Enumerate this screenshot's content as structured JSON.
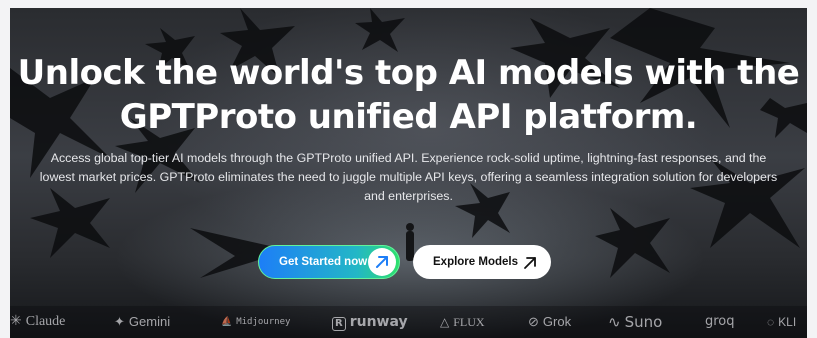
{
  "hero": {
    "title_line1": "Unlock the world's top AI models with the",
    "title_line2": "GPTProto unified API platform.",
    "subtitle_line1": "Access global top-tier AI models through the GPTProto unified API. Experience rock-solid uptime, lightning-fast responses, and the",
    "subtitle_line2": "lowest market prices. GPTProto eliminates the need to juggle multiple API keys, offering a seamless integration solution for developers",
    "subtitle_line3": "and enterprises."
  },
  "buttons": {
    "primary_label": "Get Started now",
    "primary_icon": "arrow-up-right-icon",
    "secondary_label": "Explore Models",
    "secondary_icon": "arrow-up-right-icon"
  },
  "logos": [
    {
      "name": "Claude",
      "icon": "claude-icon"
    },
    {
      "name": "Gemini",
      "icon": "gemini-sparkle-icon"
    },
    {
      "name": "Midjourney",
      "icon": "midjourney-sail-icon"
    },
    {
      "name": "runway",
      "icon": "runway-r-icon"
    },
    {
      "name": "FLUX",
      "icon": "flux-triangle-icon"
    },
    {
      "name": "Grok",
      "icon": "grok-circle-icon"
    },
    {
      "name": "Suno",
      "icon": "suno-wave-icon"
    },
    {
      "name": "groq",
      "icon": "groq-icon"
    },
    {
      "name": "KLI",
      "icon": "kling-icon"
    }
  ],
  "colors": {
    "primary_gradient_start": "#1d7ef7",
    "primary_gradient_end": "#2ee06c",
    "hero_text": "#ffffff",
    "background": "#2b2d30"
  }
}
